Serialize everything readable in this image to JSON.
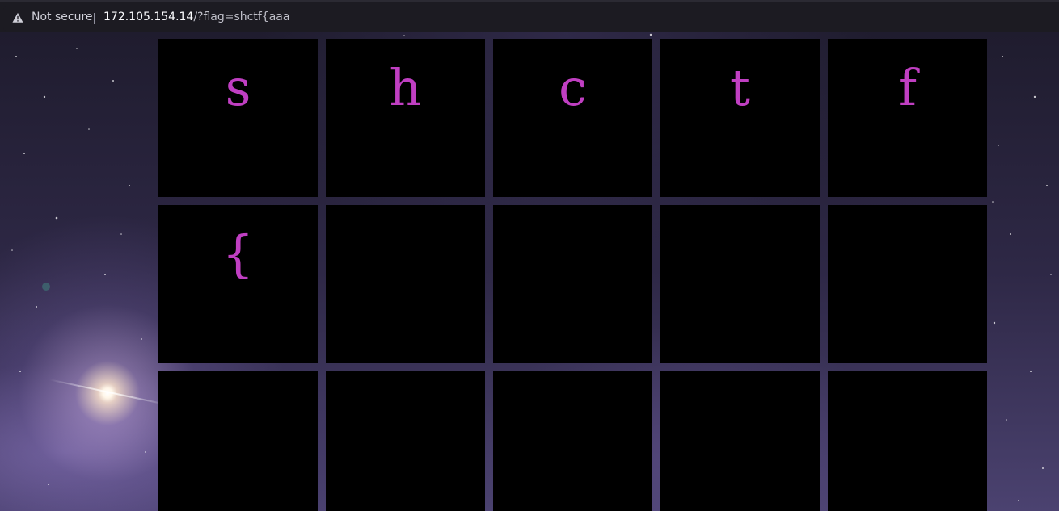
{
  "browser": {
    "security_label": "Not secure",
    "url_host": "172.105.154.14",
    "url_rest": "/?flag=shctf{aaa",
    "warning_icon": "warning-triangle-icon"
  },
  "board": {
    "cells": [
      "s",
      "h",
      "c",
      "t",
      "f",
      "{",
      "",
      "",
      "",
      "",
      "",
      "",
      "",
      "",
      ""
    ]
  },
  "colors": {
    "letter": "#c03fc2",
    "cell_background": "#000000",
    "toolbar": "#1c1b22"
  }
}
